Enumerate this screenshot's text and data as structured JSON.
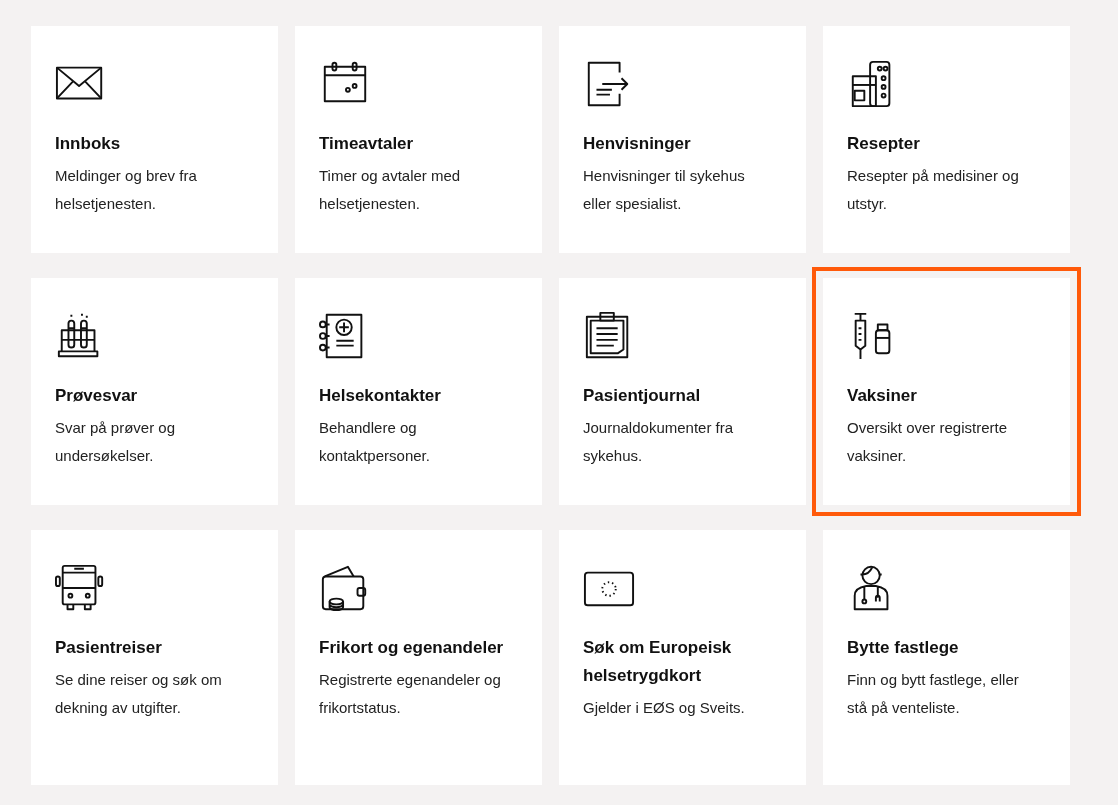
{
  "cards": [
    {
      "kind": "envelope",
      "title": "Innboks",
      "description": "Meldinger og brev fra helsetjenesten.",
      "highlighted": false
    },
    {
      "kind": "calendar",
      "title": "Timeavtaler",
      "description": "Timer og avtaler med helsetjenesten.",
      "highlighted": false
    },
    {
      "kind": "referral",
      "title": "Henvisninger",
      "description": "Henvisninger til sykehus eller spesialist.",
      "highlighted": false
    },
    {
      "kind": "pills",
      "title": "Resepter",
      "description": "Resepter på medisiner og utstyr.",
      "highlighted": false
    },
    {
      "kind": "tubes",
      "title": "Prøvesvar",
      "description": "Svar på prøver og undersøkelser.",
      "highlighted": false
    },
    {
      "kind": "notebook",
      "title": "Helsekontakter",
      "description": "Behandlere og kontaktpersoner.",
      "highlighted": false
    },
    {
      "kind": "clipboard",
      "title": "Pasientjournal",
      "description": "Journaldokumenter fra sykehus.",
      "highlighted": false
    },
    {
      "kind": "syringe",
      "title": "Vaksiner",
      "description": "Oversikt over registrerte vaksiner.",
      "highlighted": true
    },
    {
      "kind": "bus",
      "title": "Pasientreiser",
      "description": "Se dine reiser og søk om dekning av utgifter.",
      "highlighted": false
    },
    {
      "kind": "wallet",
      "title": "Frikort og egenandeler",
      "description": "Registrerte egenandeler og frikortstatus.",
      "highlighted": false
    },
    {
      "kind": "card",
      "title": "Søk om Europeisk helsetrygdkort",
      "description": "Gjelder i EØS og Sveits.",
      "highlighted": false
    },
    {
      "kind": "doctor",
      "title": "Bytte fastlege",
      "description": "Finn og bytt fastlege, eller stå på venteliste.",
      "highlighted": false
    }
  ]
}
